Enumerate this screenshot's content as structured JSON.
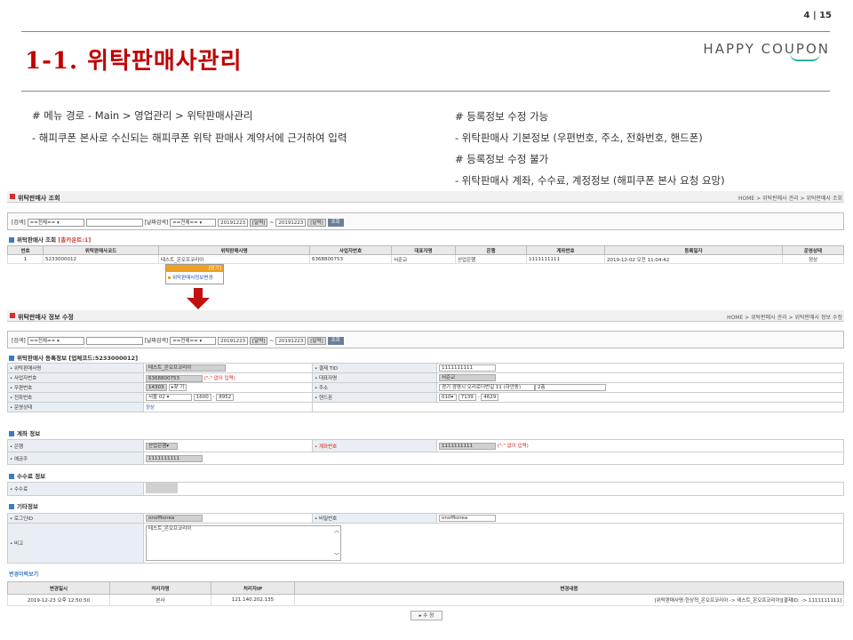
{
  "page": {
    "number": "4",
    "total": "15",
    "sep": "|"
  },
  "title": "1-1. 위탁판매사관리",
  "logo": "HAPPY COUPON",
  "notes_left": [
    "# 메뉴 경로 - Main > 영업관리 > 위탁판매사관리",
    "- 해피쿠폰 본사로 수신되는 해피쿠폰 위탁 판매사 계약서에 근거하여 입력"
  ],
  "notes_right": [
    "# 등록정보 수정 가능",
    "- 위탁판매사 기본정보 (우편번호, 주소, 전화번호, 핸드폰)",
    "# 등록정보 수정 불가",
    "- 위탁판매사 계좌, 수수료, 계정정보 (해피쿠폰 본사 요청 요망)"
  ],
  "search_bar": {
    "title": "위탁판매사 조회",
    "path": "HOME > 위탁판매사 관리 > 위탁판매사 조회"
  },
  "search": {
    "label1": "[검색]",
    "sel1": "==전체==",
    "label2": "[날짜검색]",
    "sel2": "==전체==",
    "date1": "20191223",
    "cal": "[달력]",
    "tilde": "~",
    "date2": "20191223",
    "go": "조회"
  },
  "list": {
    "title": "위탁판매사 조회",
    "count": "[총카운트:1]",
    "headers": [
      "번호",
      "위탁판매사코드",
      "위탁판매사명",
      "사업자번호",
      "대표자명",
      "은행",
      "계좌번호",
      "등록일자",
      "운영상태"
    ],
    "row": [
      "1",
      "5233000012",
      "테스트_온오프코리아",
      "6368800753",
      "서준교",
      "산업은행",
      "1111111111",
      "2019-12-02 오전 11:04:42",
      "정상"
    ]
  },
  "popup": {
    "header": "[닫기]",
    "item": "위탁판매사정보변경"
  },
  "edit_bar": {
    "title": "위탁판매사 정보 수정",
    "path": "HOME > 위탁판매사 관리 > 위탁판매사 정보 수정"
  },
  "reg": {
    "title": "위탁판매사 등록정보 [업체코드:5233000012]",
    "name_k": "• 위탁판매사명",
    "name_v": "테스트_온오프코리아",
    "tid_k": "• 결제 TID",
    "tid_v": "1111111111",
    "biz_k": "• 사업자번호",
    "biz_v": "6368800753",
    "biz_note": "(\"-\" 없이 입력)",
    "ceo_k": "• 대표자명",
    "ceo_v": "서준교",
    "zip_k": "• 우편번호",
    "zip_v": "14303",
    "zip_btn": "▸찾 기",
    "addr_k": "• 주소",
    "addr_v": "경기 광명시 오리로더번길 11 (하안동)",
    "addr_v2": "2층",
    "tel_k": "• 전화번호",
    "tel_1": "서울 02",
    "tel_2": "1600",
    "tel_3": "8952",
    "dash": "-",
    "hp_k": "• 핸드폰",
    "hp_1": "010",
    "hp_2": "7139",
    "hp_3": "4629",
    "status_k": "• 운영상태",
    "status_v": "정상"
  },
  "account": {
    "title": "계좌 정보",
    "bank_k": "• 은행",
    "bank_v": "산업은행",
    "acct_k": "• 계좌번호",
    "acct_v": "1111111111",
    "acct_note": "(\"-\" 없이 입력)",
    "holder_k": "• 예금주",
    "holder_v": "1111111111"
  },
  "fee": {
    "title": "수수료 정보",
    "fee_k": "• 수수료"
  },
  "etc": {
    "title": "기타정보",
    "login_k": "• 로그인ID",
    "login_v": "onoffkorea",
    "pw_k": "• 비밀번호",
    "pw_v": "onoffkorea",
    "memo_k": "• 비고",
    "memo_v": "테스트_온오프코리아"
  },
  "history": {
    "title": "변경이력보기",
    "headers": [
      "변경일시",
      "처리자명",
      "처리자IP",
      "변경내용"
    ],
    "row": [
      "2019-12-23 오후 12:50:50",
      "본사",
      "121.140.202.135",
      "[위탁판매사명:한상혁_온오프코리아 -> 테스트_온오프코리아][결제ID: -> 1111111111]"
    ]
  },
  "submit": "▸ 수 정"
}
